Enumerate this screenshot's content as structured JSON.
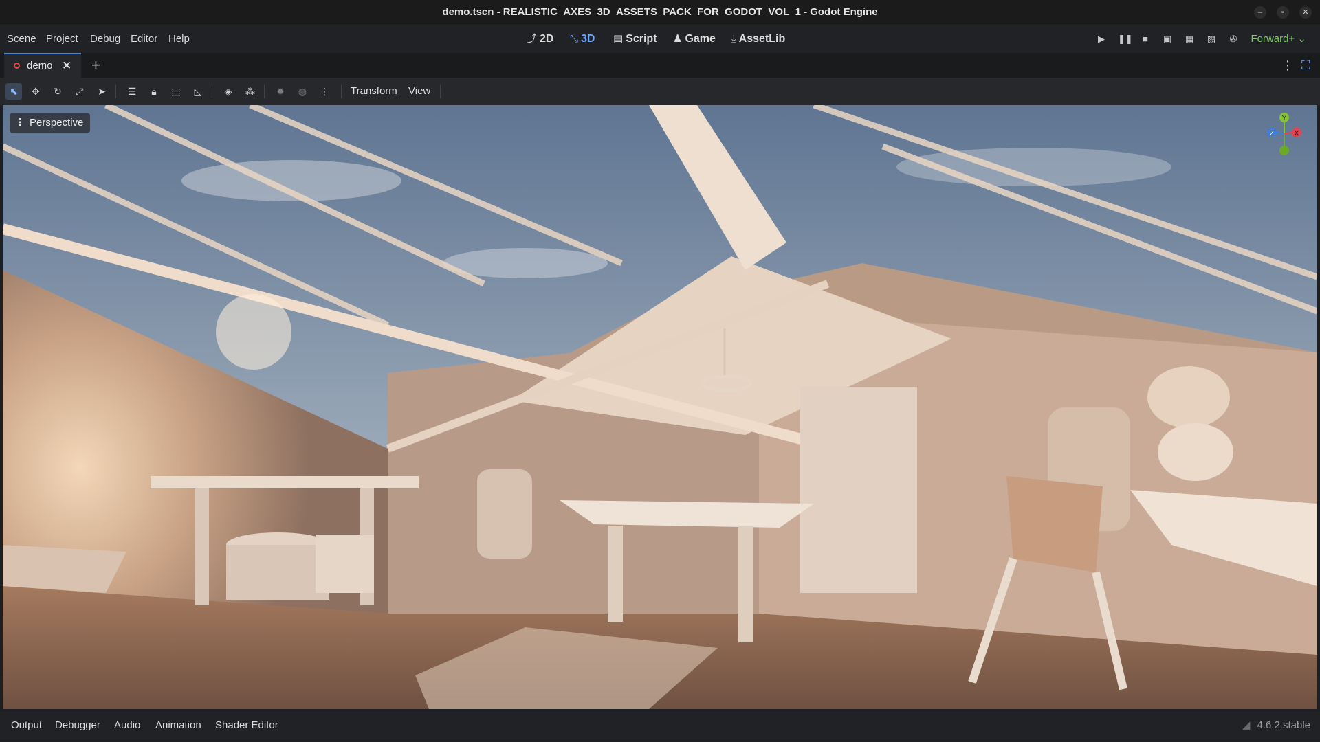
{
  "window": {
    "title": "demo.tscn - REALISTIC_AXES_3D_ASSETS_PACK_FOR_GODOT_VOL_1 - Godot Engine",
    "controls": [
      "minimize-icon",
      "maximize-icon",
      "close-icon"
    ]
  },
  "menu": {
    "items": [
      "Scene",
      "Project",
      "Debug",
      "Editor",
      "Help"
    ]
  },
  "workspaces": [
    {
      "label": "2D",
      "icon": "2d-icon",
      "active": false
    },
    {
      "label": "3D",
      "icon": "3d-icon",
      "active": true
    },
    {
      "label": "Script",
      "icon": "script-icon",
      "active": false
    },
    {
      "label": "Game",
      "icon": "game-icon",
      "active": false
    },
    {
      "label": "AssetLib",
      "icon": "assetlib-icon",
      "active": false
    }
  ],
  "run_controls": [
    "play-icon",
    "pause-icon",
    "stop-icon",
    "remote-debug-icon",
    "play-scene-icon",
    "play-custom-scene-icon",
    "movie-maker-icon"
  ],
  "renderer": "Forward+",
  "scene_tabs": [
    {
      "label": "demo",
      "active": true
    }
  ],
  "toolbar": {
    "tools": [
      "select-tool-icon",
      "move-tool-icon",
      "rotate-tool-icon",
      "scale-tool-icon",
      "list-select-icon",
      "script-list-icon",
      "lock-icon",
      "group-icon",
      "ruler-icon",
      "snap-icon",
      "use-local-space-icon",
      "sun-icon",
      "environment-icon",
      "more-icon"
    ],
    "menus": [
      "Transform",
      "View"
    ]
  },
  "viewport": {
    "mode_label": "Perspective",
    "gizmo_axes": [
      "Y",
      "Z",
      "X"
    ],
    "colors": {
      "x": "#e8414d",
      "y": "#84c436",
      "z": "#3e7fe0"
    }
  },
  "bottom_panel": {
    "tabs": [
      "Output",
      "Debugger",
      "Audio",
      "Animation",
      "Shader Editor"
    ],
    "version": "4.6.2.stable"
  }
}
